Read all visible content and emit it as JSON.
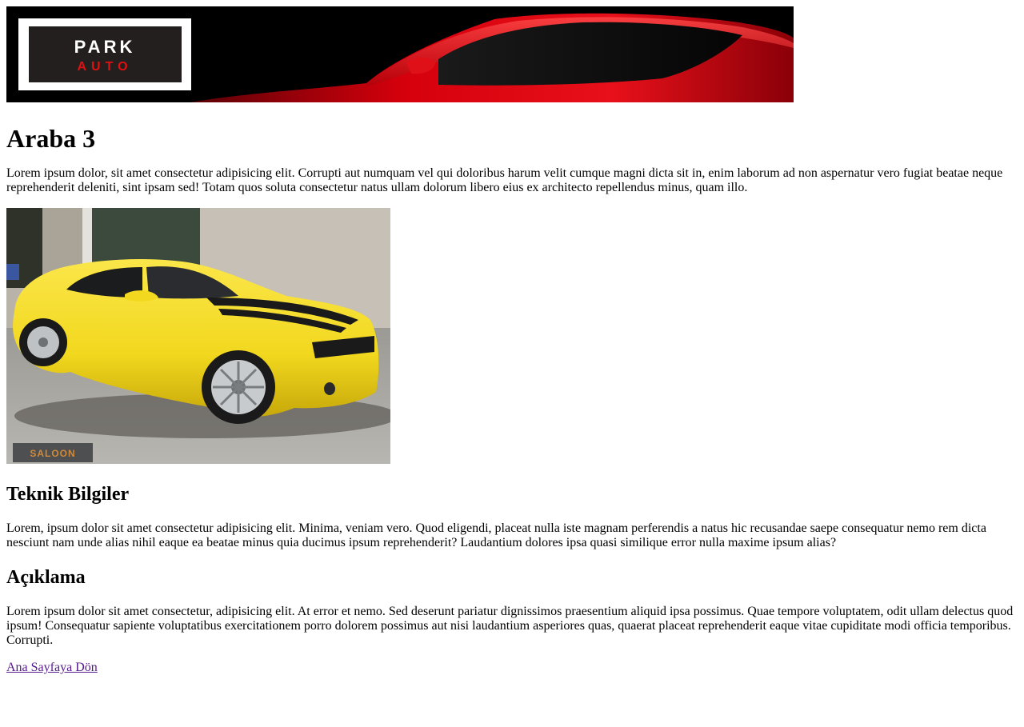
{
  "banner": {
    "logo_top": "PARK",
    "logo_bottom": "AUTO",
    "background_color": "#000000",
    "car_color": "#d4000c",
    "logo_text_top_color": "#ffffff",
    "logo_text_bottom_color": "#e01010"
  },
  "page": {
    "title": "Araba 3",
    "intro": "Lorem ipsum dolor, sit amet consectetur adipisicing elit. Corrupti aut numquam vel qui doloribus harum velit cumque magni dicta sit in, enim laborum ad non aspernatur vero fugiat beatae neque reprehenderit deleniti, sint ipsam sed! Totam quos soluta consectetur natus ullam dolorum libero eius ex architecto repellendus minus, quam illo."
  },
  "car_image": {
    "car_color": "#f2d81e",
    "watermark": "SALOON"
  },
  "technical": {
    "heading": "Teknik Bilgiler",
    "text": "Lorem, ipsum dolor sit amet consectetur adipisicing elit. Minima, veniam vero. Quod eligendi, placeat nulla iste magnam perferendis a natus hic recusandae saepe consequatur nemo rem dicta nesciunt nam unde alias nihil eaque ea beatae minus quia ducimus ipsum reprehenderit? Laudantium dolores ipsa quasi similique error nulla maxime ipsum alias?"
  },
  "description": {
    "heading": "Açıklama",
    "text": "Lorem ipsum dolor sit amet consectetur, adipisicing elit. At error et nemo. Sed deserunt pariatur dignissimos praesentium aliquid ipsa possimus. Quae tempore voluptatem, odit ullam delectus quod ipsum! Consequatur sapiente voluptatibus exercitationem porro dolorem possimus aut nisi laudantium asperiores quas, quaerat placeat reprehenderit eaque vitae cupiditate modi officia temporibus. Corrupti."
  },
  "nav": {
    "back_link": "Ana Sayfaya Dön"
  }
}
